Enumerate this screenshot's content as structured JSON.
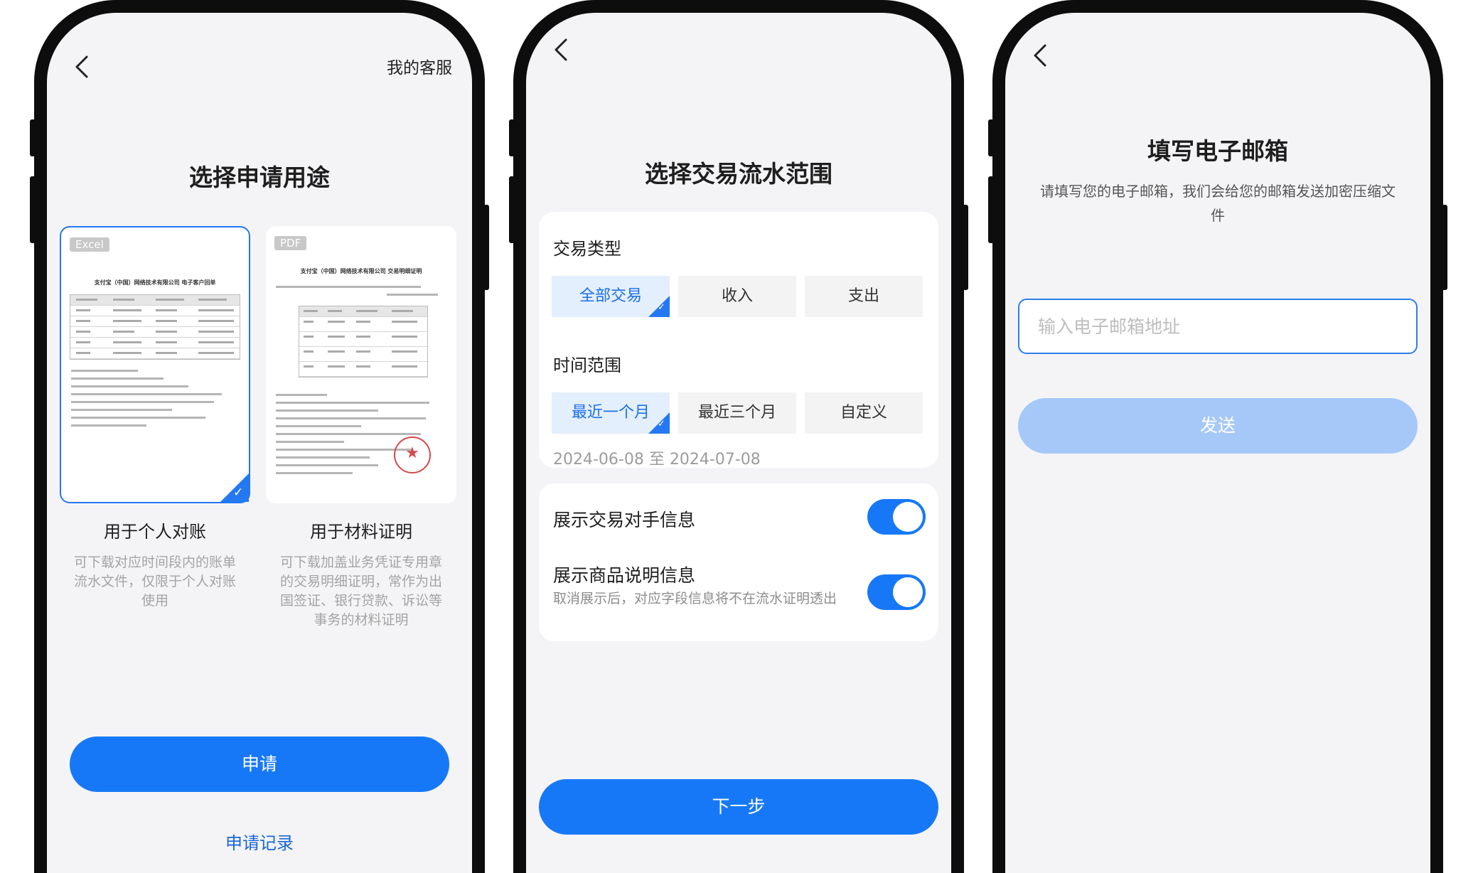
{
  "screen1": {
    "customer_service": "我的客服",
    "title": "选择申请用途",
    "cards": [
      {
        "tag": "Excel",
        "doc_title": "支付宝（中国）网络技术有限公司 电子客户回单",
        "label": "用于个人对账",
        "desc": "可下载对应时间段内的账单流水文件，仅限于个人对账使用",
        "selected": true
      },
      {
        "tag": "PDF",
        "doc_title": "支付宝（中国）网络技术有限公司 交易明细证明",
        "label": "用于材料证明",
        "desc": "可下载加盖业务凭证专用章的交易明细证明，常作为出国签证、银行贷款、诉讼等事务的材料证明",
        "selected": false
      }
    ],
    "apply_button": "申请",
    "records_link": "申请记录"
  },
  "screen2": {
    "title": "选择交易流水范围",
    "type_label": "交易类型",
    "type_options": [
      "全部交易",
      "收入",
      "支出"
    ],
    "type_selected": "全部交易",
    "time_label": "时间范围",
    "time_options": [
      "最近一个月",
      "最近三个月",
      "自定义"
    ],
    "time_selected": "最近一个月",
    "date_range": "2024-06-08 至 2024-07-08",
    "toggles": [
      {
        "label": "展示交易对手信息",
        "on": true
      },
      {
        "label": "展示商品说明信息",
        "desc": "取消展示后，对应字段信息将不在流水证明透出",
        "on": true
      }
    ],
    "next_button": "下一步"
  },
  "screen3": {
    "title": "填写电子邮箱",
    "subtitle": "请填写您的电子邮箱，我们会给您的邮箱发送加密压缩文件",
    "email_placeholder": "输入电子邮箱地址",
    "send_button": "发送"
  },
  "colors": {
    "primary": "#1778f7",
    "primary_disabled": "#a6c8f8",
    "chip_active_bg": "#e4effd",
    "screen_bg": "#f4f4f6"
  }
}
